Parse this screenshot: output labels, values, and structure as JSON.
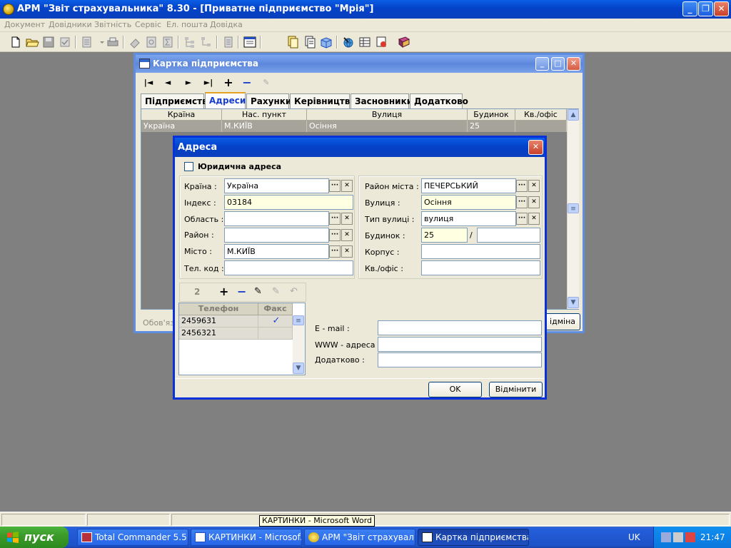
{
  "app": {
    "title": "АРМ \"Звіт страхувальника\" 8.30 - [Приватне підприємство \"Мрія\"]"
  },
  "menu": [
    "Документ",
    "Довідники",
    "Звітність",
    "Сервіс",
    "Ел. пошта",
    "Довідка"
  ],
  "card_window": {
    "title": "Картка підприємства",
    "tabs": [
      "Підприємство",
      "Адреси",
      "Рахунки",
      "Керівництво",
      "Засновники",
      "Додатково"
    ],
    "active_tab": "Адреси",
    "grid": {
      "columns": [
        "Країна",
        "Нас. пункт",
        "Вулиця",
        "Будинок",
        "Кв./офіс"
      ],
      "rows": [
        [
          "Україна",
          "М.КИЇВ",
          "Осіння",
          "25",
          ""
        ]
      ]
    },
    "status_text": "Обов'язк",
    "cancel_label": "ідміна"
  },
  "address_dialog": {
    "title": "Адреса",
    "legal_address_label": "Юридична адреса",
    "legal_address_checked": false,
    "left_fields": [
      {
        "label": "Країна :",
        "value": "Україна",
        "yellow": false,
        "buttons": true
      },
      {
        "label": "Індекс :",
        "value": "03184",
        "yellow": true,
        "buttons": false
      },
      {
        "label": "Область :",
        "value": "",
        "yellow": false,
        "buttons": true
      },
      {
        "label": "Район :",
        "value": "",
        "yellow": false,
        "buttons": true
      },
      {
        "label": "Місто :",
        "value": "М.КИЇВ",
        "yellow": false,
        "buttons": true
      },
      {
        "label": "Тел. код :",
        "value": "",
        "yellow": false,
        "buttons": false
      }
    ],
    "right_fields": [
      {
        "label": "Район міста :",
        "value": "ПЕЧЕРСЬКИЙ",
        "yellow": false,
        "buttons": true
      },
      {
        "label": "Вулиця :",
        "value": "Осіння",
        "yellow": true,
        "buttons": true
      },
      {
        "label": "Тип вулиці :",
        "value": "вулиця",
        "yellow": false,
        "buttons": true
      },
      {
        "label": "Будинок :",
        "value": "25",
        "yellow": true,
        "buttons": false
      },
      {
        "label": "Корпус :",
        "value": "",
        "yellow": false,
        "buttons": false
      },
      {
        "label": "Кв./офіс :",
        "value": "",
        "yellow": false,
        "buttons": false
      }
    ],
    "building_separator": "/",
    "phones": {
      "count": "2",
      "columns": [
        "Телефон",
        "Факс"
      ],
      "rows": [
        {
          "phone": "2459631",
          "fax": true
        },
        {
          "phone": "2456321",
          "fax": false
        }
      ]
    },
    "contact_fields": [
      {
        "label": "E - mail :",
        "value": ""
      },
      {
        "label": "WWW - адреса :",
        "value": ""
      },
      {
        "label": "Додатково :",
        "value": ""
      }
    ],
    "ok_label": "OK",
    "cancel_label": "Відмінити"
  },
  "statusbar": {
    "tooltip": "КАРТИНКИ - Microsoft Word"
  },
  "taskbar": {
    "start_label": "пуск",
    "tasks": [
      {
        "label": "Total Commander 5.5...",
        "active": false
      },
      {
        "label": "КАРТИНКИ - Microsof...",
        "active": false
      },
      {
        "label": "АРМ \"Звіт страхувал...",
        "active": false
      },
      {
        "label": "Картка підприємства",
        "active": true
      }
    ],
    "language": "UK",
    "clock": "21:47"
  },
  "colors": {
    "xp_blue": "#0a4fd6",
    "desktop_gray": "#808080",
    "field_yellow": "#ffffe1",
    "active_tab_text": "#1a3ecf"
  }
}
